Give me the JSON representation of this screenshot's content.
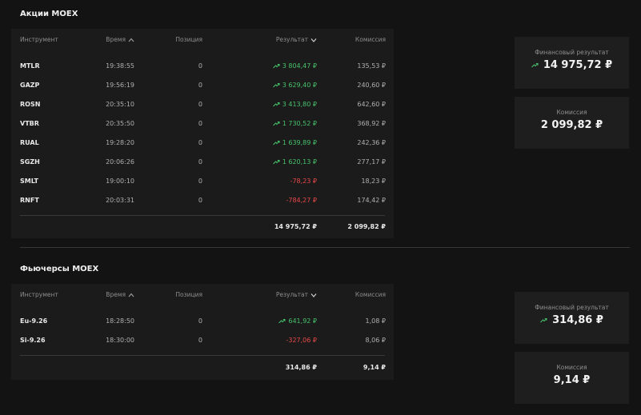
{
  "stocks": {
    "title": "Акции MOEX",
    "columns": {
      "instrument": "Инструмент",
      "time": "Время",
      "position": "Позиция",
      "result": "Результат",
      "commission": "Комиссия"
    },
    "rows": [
      {
        "instrument": "MTLR",
        "time": "19:38:55",
        "position": "0",
        "result": "3 804,47 ₽",
        "commission": "135,53 ₽",
        "trend": "up"
      },
      {
        "instrument": "GAZP",
        "time": "19:56:19",
        "position": "0",
        "result": "3 629,40 ₽",
        "commission": "240,60 ₽",
        "trend": "up"
      },
      {
        "instrument": "ROSN",
        "time": "20:35:10",
        "position": "0",
        "result": "3 413,80 ₽",
        "commission": "642,60 ₽",
        "trend": "up"
      },
      {
        "instrument": "VTBR",
        "time": "20:35:50",
        "position": "0",
        "result": "1 730,52 ₽",
        "commission": "368,92 ₽",
        "trend": "up"
      },
      {
        "instrument": "RUAL",
        "time": "19:28:20",
        "position": "0",
        "result": "1 639,89 ₽",
        "commission": "242,36 ₽",
        "trend": "up"
      },
      {
        "instrument": "SGZH",
        "time": "20:06:26",
        "position": "0",
        "result": "1 620,13 ₽",
        "commission": "277,17 ₽",
        "trend": "up"
      },
      {
        "instrument": "SMLT",
        "time": "19:00:10",
        "position": "0",
        "result": "-78,23 ₽",
        "commission": "18,23 ₽",
        "trend": "down"
      },
      {
        "instrument": "RNFT",
        "time": "20:03:31",
        "position": "0",
        "result": "-784,27 ₽",
        "commission": "174,42 ₽",
        "trend": "down"
      }
    ],
    "totals": {
      "result": "14 975,72 ₽",
      "commission": "2 099,82 ₽"
    },
    "summary": {
      "financial_label": "Финансовый результат",
      "financial_value": "14 975,72 ₽",
      "commission_label": "Комиссия",
      "commission_value": "2 099,82 ₽"
    }
  },
  "futures": {
    "title": "Фьючерсы MOEX",
    "columns": {
      "instrument": "Инструмент",
      "time": "Время",
      "position": "Позиция",
      "result": "Результат",
      "commission": "Комиссия"
    },
    "rows": [
      {
        "instrument": "Eu-9.26",
        "time": "18:28:50",
        "position": "0",
        "result": "641,92 ₽",
        "commission": "1,08 ₽",
        "trend": "up"
      },
      {
        "instrument": "Si-9.26",
        "time": "18:30:00",
        "position": "0",
        "result": "-327,06 ₽",
        "commission": "8,06 ₽",
        "trend": "down"
      }
    ],
    "totals": {
      "result": "314,86 ₽",
      "commission": "9,14 ₽"
    },
    "summary": {
      "financial_label": "Финансовый результат",
      "financial_value": "314,86 ₽",
      "commission_label": "Комиссия",
      "commission_value": "9,14 ₽"
    }
  },
  "colors": {
    "positive": "#47c26b",
    "negative": "#e84848",
    "background": "#131313",
    "panel": "#1b1b1b"
  }
}
